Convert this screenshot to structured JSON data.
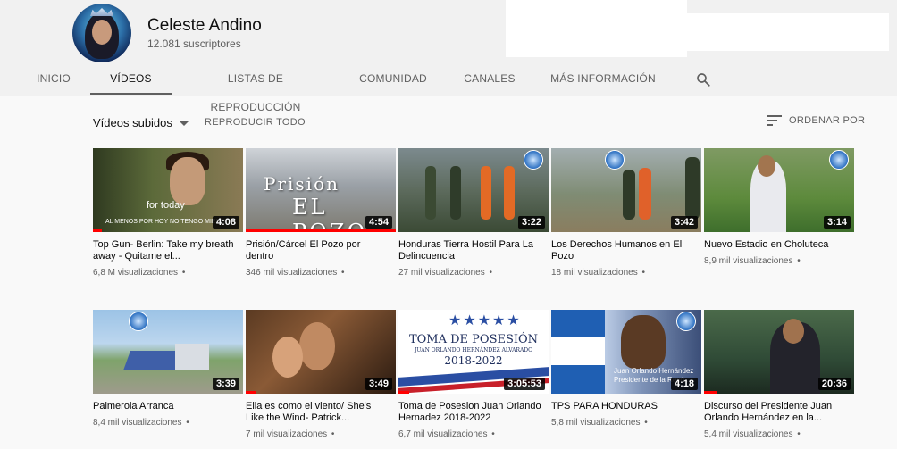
{
  "channel": {
    "name": "Celeste Andino",
    "subscribers": "12.081 suscriptores"
  },
  "tabs": [
    {
      "label": "INICIO"
    },
    {
      "label": "VÍDEOS",
      "active": true
    },
    {
      "label": "LISTAS DE REPRODUCCIÓN"
    },
    {
      "label": "COMUNIDAD"
    },
    {
      "label": "CANALES"
    },
    {
      "label": "MÁS INFORMACIÓN"
    }
  ],
  "toolbar": {
    "filter_label": "Vídeos subidos",
    "play_all_label": "REPRODUCIR TODO",
    "sort_label": "ORDENAR POR"
  },
  "thumb_text": {
    "topgun_caption": "for today",
    "topgun_subtitle": "AL MENOS POR HOY NO TENGO MIEDO",
    "pozo_line1": "Prisión",
    "pozo_line2": "EL POZO",
    "posesion_line1": "TOMA DE POSESIÓN",
    "posesion_line2": "JUAN ORLANDO HERNÁNDEZ ALVARADO",
    "posesion_line3": "2018-2022",
    "tps_caption1": "Juan Orlando Hernández",
    "tps_caption2": "Presidente de la Repú..."
  },
  "videos": [
    {
      "title": "Top Gun- Berlin: Take my breath away - Quitame el...",
      "views": "6,8 M visualizaciones",
      "duration": "4:08"
    },
    {
      "title": "Prisión/Cárcel El Pozo por dentro",
      "views": "346 mil visualizaciones",
      "duration": "4:54"
    },
    {
      "title": "Honduras Tierra Hostil Para La Delincuencia",
      "views": "27 mil visualizaciones",
      "duration": "3:22"
    },
    {
      "title": "Los Derechos Humanos en El Pozo",
      "views": "18 mil visualizaciones",
      "duration": "3:42"
    },
    {
      "title": "Nuevo Estadio en Choluteca",
      "views": "8,9 mil visualizaciones",
      "duration": "3:14"
    },
    {
      "title": "Palmerola Arranca",
      "views": "8,4 mil visualizaciones",
      "duration": "3:39"
    },
    {
      "title": "Ella es como el viento/ She's Like the Wind- Patrick...",
      "views": "7 mil visualizaciones",
      "duration": "3:49"
    },
    {
      "title": "Toma de Posesion Juan Orlando Hernadez 2018-2022",
      "views": "6,7 mil visualizaciones",
      "duration": "3:05:53"
    },
    {
      "title": "TPS PARA HONDURAS",
      "views": "5,8 mil visualizaciones",
      "duration": "4:18"
    },
    {
      "title": "Discurso del Presidente Juan Orlando Hernández en la...",
      "views": "5,4 mil visualizaciones",
      "duration": "20:36"
    }
  ]
}
